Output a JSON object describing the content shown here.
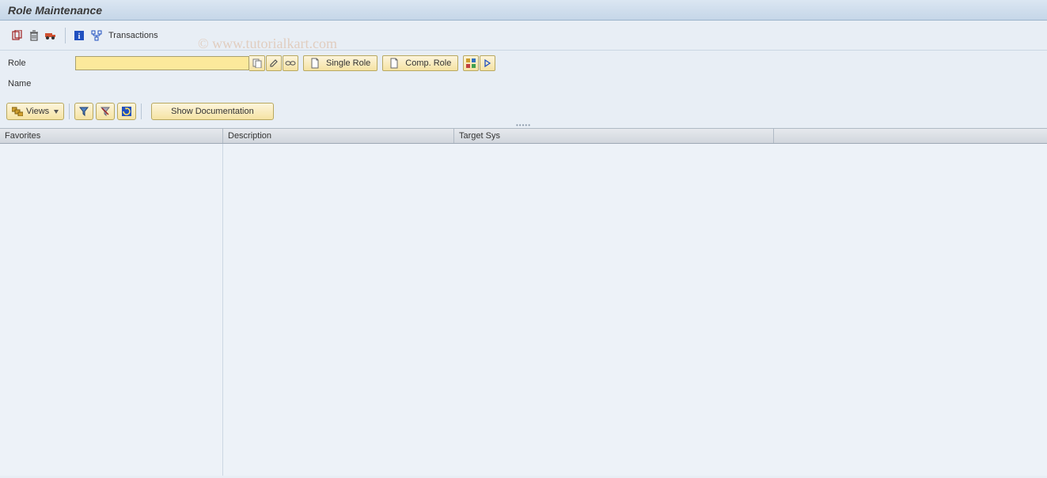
{
  "title": "Role Maintenance",
  "toolbar": {
    "transactions_label": "Transactions"
  },
  "form": {
    "role_label": "Role",
    "role_value": "",
    "name_label": "Name",
    "single_role_label": "Single Role",
    "comp_role_label": "Comp. Role"
  },
  "second_toolbar": {
    "views_label": "Views",
    "show_doc_label": "Show Documentation"
  },
  "grid_headers": {
    "favorites": "Favorites",
    "description": "Description",
    "target_sys": "Target Sys"
  },
  "watermark": "© www.tutorialkart.com"
}
